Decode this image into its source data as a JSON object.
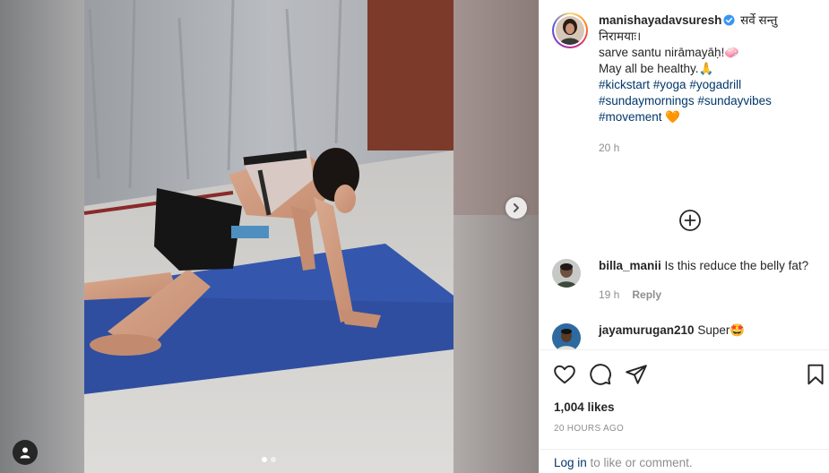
{
  "post": {
    "username": "manishayadavsuresh",
    "caption_lines": [
      "सर्वे सन्तु निरामयाः।",
      "sarve santu nirāmayāḥ!",
      "May all be healthy."
    ],
    "caption_emojis": [
      "🧼",
      "🙏"
    ],
    "hashtags": [
      "#kickstart",
      "#yoga",
      "#yogadrill",
      "#sundaymornings",
      "#sundayvibes",
      "#movement"
    ],
    "hashtag_emoji": "🧡",
    "time": "20 h"
  },
  "comments": [
    {
      "username": "billa_manii",
      "text": "Is this reduce the belly fat?",
      "time": "19 h",
      "reply_label": "Reply"
    },
    {
      "username": "jayamurugan210",
      "text": "Super",
      "emoji": "🤩"
    }
  ],
  "stats": {
    "likes": "1,004 likes",
    "posted": "20 HOURS AGO"
  },
  "footer": {
    "login_label": "Log in",
    "login_suffix": " to like or comment."
  },
  "media": {
    "slides": 2,
    "active_slide": 1
  },
  "icons": {
    "verified": "verified-badge-icon",
    "load_more": "plus-circle-icon",
    "like": "heart-icon",
    "comment": "comment-icon",
    "share": "paper-plane-icon",
    "save": "bookmark-icon",
    "next": "chevron-right-icon",
    "user_tag": "user-icon"
  },
  "colors": {
    "link": "#00376b",
    "verified": "#3897f0",
    "mat": "#2f4ea0",
    "muted": "#8e8e8e"
  }
}
